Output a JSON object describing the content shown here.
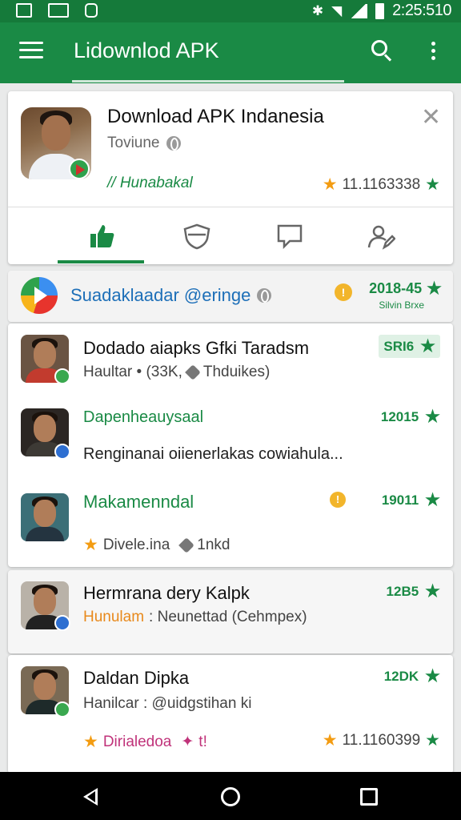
{
  "status_bar": {
    "time": "2:25:510"
  },
  "app_bar": {
    "title": "Lidownlod APK"
  },
  "app_card": {
    "name": "Download APK Indanesia",
    "subtitle": "Toviune",
    "link_text": "// Hunabakal",
    "rating_value": "11.1163338"
  },
  "tabs": [
    {
      "name": "like",
      "icon": "thumbs-up-icon",
      "active": true
    },
    {
      "name": "shield",
      "icon": "shield-icon",
      "active": false
    },
    {
      "name": "chat",
      "icon": "chat-bubble-icon",
      "active": false
    },
    {
      "name": "edit",
      "icon": "edit-profile-icon",
      "active": false
    }
  ],
  "banner": {
    "text": "Suadaklaadar @eringe",
    "rating": "2018-45",
    "subtext": "Silvin Brxe"
  },
  "rows": [
    {
      "title": "Dodado aiapks Gfki Taradsm",
      "subtitle": "Haultar  •  (33K,",
      "subtitle_tail": "Thduikes)",
      "value": "SRI6"
    },
    {
      "title": "Dapenheauysaal",
      "body": "Renginanai oiienerlakas cowiahula...",
      "value": "12015"
    },
    {
      "title": "Makamenndal",
      "meta_author": "Divele.ina",
      "meta_tag": "1nkd",
      "value": "19011"
    },
    {
      "title": "Hermrana dery Kalpk",
      "subtitle_highlight": "Hunulam",
      "subtitle_rest": ": Neunettad (Cehmpex)",
      "value": "12B5"
    },
    {
      "title": "Daldan Dipka",
      "subtitle": "Hanilcar  :  @uidgstihan ki",
      "meta_pink": "Dirialedoa",
      "meta_pink_tag": "t!",
      "value": "12DK",
      "rating_value": "11.1160399"
    }
  ],
  "colors": {
    "status_bar": "#157a3a",
    "app_bar": "#1a8a45",
    "accent_green": "#1a8a45",
    "star_orange": "#f39c12",
    "link_blue": "#1d6fb8"
  }
}
